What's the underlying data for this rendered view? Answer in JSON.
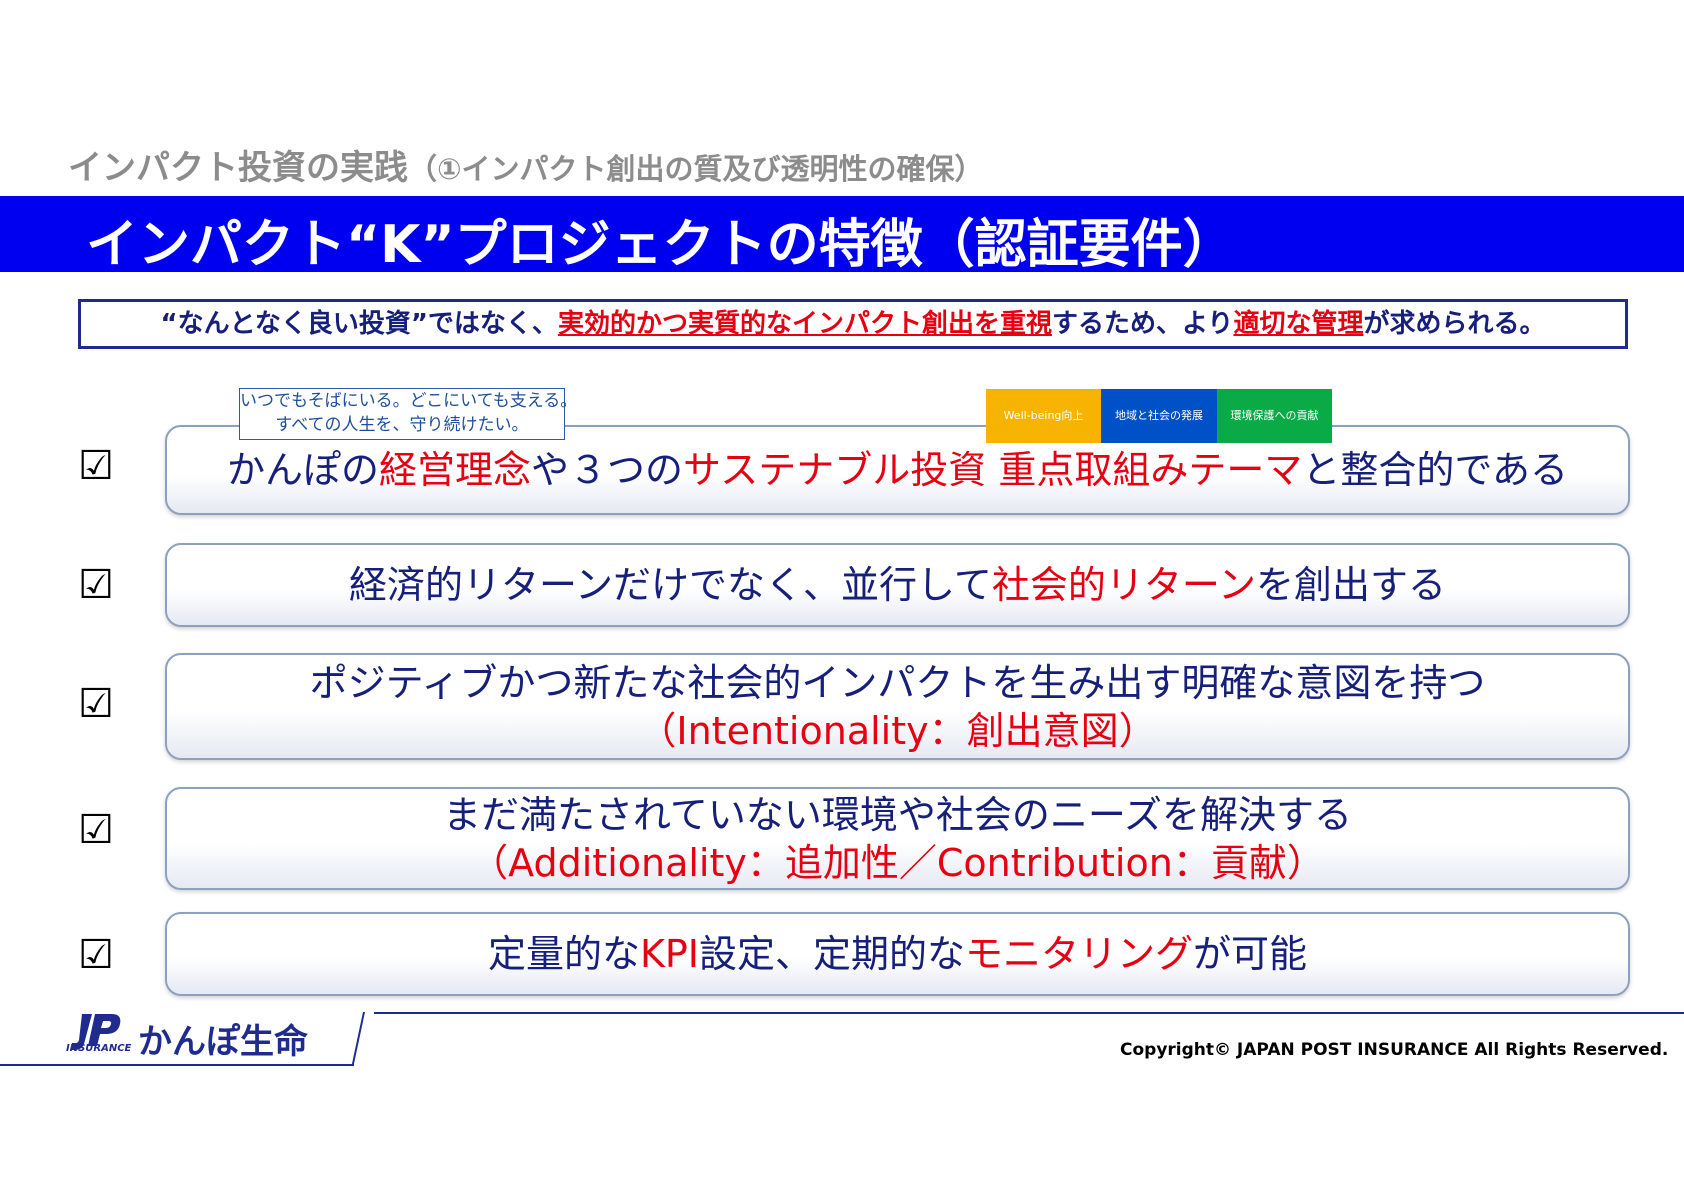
{
  "header": {
    "subtitle_main": "インパクト投資の実践",
    "subtitle_paren": "（①インパクト創出の質及び透明性の確保）",
    "title": "インパクト“K”プロジェクトの特徴（認証要件）"
  },
  "lead": {
    "part1": "“なんとなく良い投資”ではなく、",
    "part2": "実効的かつ実質的なインパクト創出を重視",
    "part3": "するため、より",
    "part4": "適切な管理",
    "part5": "が求められる。"
  },
  "stamp": {
    "line1": "いつでもそばにいる。どこにいても支える。",
    "line2": "すべての人生を、守り続けたい。"
  },
  "themes": [
    {
      "label": "Well-being向上",
      "color": "#f6b400"
    },
    {
      "label": "地域と社会の発展",
      "color": "#0050c8"
    },
    {
      "label": "環境保護への貢献",
      "color": "#0aaa46"
    }
  ],
  "check_icon": "check-box-icon",
  "check_glyph": "☑",
  "requirements": [
    {
      "l1": "かんぽの",
      "l2": "経営理念",
      "l3": "や３つの",
      "l4": "サステナブル投資 重点取組みテーマ",
      "l5": "と整合的である"
    },
    {
      "l1": "経済的リターンだけでなく、並行して",
      "l2": "社会的リターン",
      "l3": "を創出する"
    },
    {
      "line1": "ポジティブかつ新たな社会的インパクトを生み出す明確な意図を持つ",
      "line2": "（Intentionality：創出意図）"
    },
    {
      "line1": "まだ満たされていない環境や社会のニーズを解決する",
      "line2": "（Additionality：追加性／Contribution：貢献）"
    },
    {
      "l1": "定量的な",
      "l2": "KPI",
      "l3": "設定、定期的な",
      "l4": "モニタリング",
      "l5": "が可能"
    }
  ],
  "footer": {
    "logo_mark": "JP",
    "logo_sub": "INSURANCE",
    "company": "かんぽ生命",
    "copyright": "Copyright© JAPAN POST INSURANCE All Rights Reserved."
  },
  "colors": {
    "accent_blue": "#0000f0",
    "navy_text": "#16207a",
    "emphasis_red": "#e60012"
  }
}
